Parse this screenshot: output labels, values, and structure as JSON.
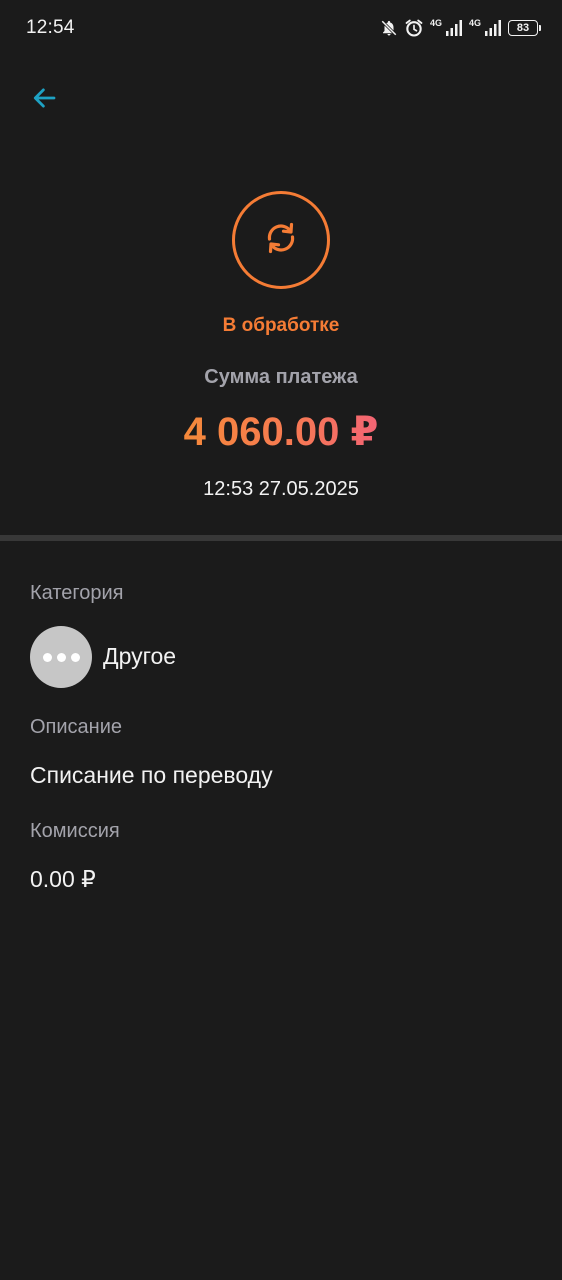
{
  "status_bar": {
    "time": "12:54",
    "network1": "4G",
    "network2": "4G",
    "battery": "83"
  },
  "transaction": {
    "status": "В обработке",
    "amount_label": "Сумма платежа",
    "amount": "4 060.00 ₽",
    "datetime": "12:53 27.05.2025"
  },
  "details": {
    "category_label": "Категория",
    "category_value": "Другое",
    "description_label": "Описание",
    "description_value": "Списание по переводу",
    "commission_label": "Комиссия",
    "commission_value": "0.00 ₽"
  },
  "colors": {
    "accent": "#f57c35",
    "back_arrow": "#1ea2c4",
    "background": "#1b1b1b"
  },
  "icons": {
    "back": "arrow-left-icon",
    "status": "refresh-icon",
    "category": "more-dots-icon"
  }
}
